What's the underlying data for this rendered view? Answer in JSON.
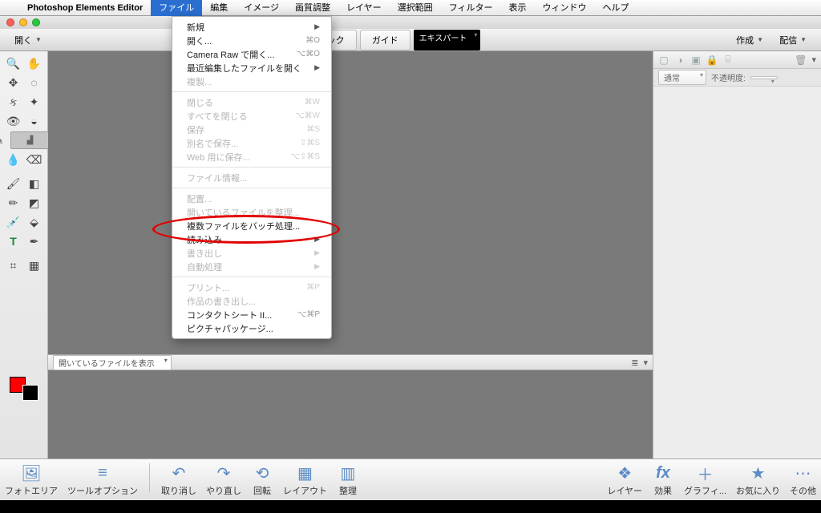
{
  "menubar": {
    "app_name": "Photoshop Elements Editor",
    "items": [
      "ファイル",
      "編集",
      "イメージ",
      "画質調整",
      "レイヤー",
      "選択範囲",
      "フィルター",
      "表示",
      "ウィンドウ",
      "ヘルプ"
    ],
    "active_index": 0
  },
  "topbar": {
    "open_label": "開く",
    "create_label": "作成",
    "deliver_label": "配信",
    "mode_tabs": [
      "クイック",
      "ガイド",
      "エキスパート"
    ],
    "mode_selected": 2
  },
  "file_menu": {
    "groups": [
      [
        {
          "label": "新規",
          "shortcut": "",
          "arrow": true,
          "disabled": false
        },
        {
          "label": "開く...",
          "shortcut": "⌘O",
          "arrow": false,
          "disabled": false
        },
        {
          "label": "Camera Raw で開く...",
          "shortcut": "⌥⌘O",
          "arrow": false,
          "disabled": false
        },
        {
          "label": "最近編集したファイルを開く",
          "shortcut": "",
          "arrow": true,
          "disabled": false
        },
        {
          "label": "複製...",
          "shortcut": "",
          "arrow": false,
          "disabled": true
        }
      ],
      [
        {
          "label": "閉じる",
          "shortcut": "⌘W",
          "arrow": false,
          "disabled": true
        },
        {
          "label": "すべてを閉じる",
          "shortcut": "⌥⌘W",
          "arrow": false,
          "disabled": true
        },
        {
          "label": "保存",
          "shortcut": "⌘S",
          "arrow": false,
          "disabled": true
        },
        {
          "label": "別名で保存...",
          "shortcut": "⇧⌘S",
          "arrow": false,
          "disabled": true
        },
        {
          "label": "Web 用に保存...",
          "shortcut": "⌥⇧⌘S",
          "arrow": false,
          "disabled": true
        }
      ],
      [
        {
          "label": "ファイル情報...",
          "shortcut": "",
          "arrow": false,
          "disabled": true
        }
      ],
      [
        {
          "label": "配置...",
          "shortcut": "",
          "arrow": false,
          "disabled": true
        },
        {
          "label": "開いているファイルを整理...",
          "shortcut": "",
          "arrow": false,
          "disabled": true
        },
        {
          "label": "複数ファイルをバッチ処理...",
          "shortcut": "",
          "arrow": false,
          "disabled": false
        },
        {
          "label": "読み込み",
          "shortcut": "",
          "arrow": true,
          "disabled": false
        },
        {
          "label": "書き出し",
          "shortcut": "",
          "arrow": true,
          "disabled": true
        },
        {
          "label": "自動処理",
          "shortcut": "",
          "arrow": true,
          "disabled": true
        }
      ],
      [
        {
          "label": "プリント...",
          "shortcut": "⌘P",
          "arrow": false,
          "disabled": true
        },
        {
          "label": "作品の書き出し...",
          "shortcut": "",
          "arrow": false,
          "disabled": true
        },
        {
          "label": "コンタクトシート II...",
          "shortcut": "⌥⌘P",
          "arrow": false,
          "disabled": false
        },
        {
          "label": "ピクチャパッケージ...",
          "shortcut": "",
          "arrow": false,
          "disabled": false
        }
      ]
    ]
  },
  "file_dropdown": {
    "label": "開いているファイルを表示"
  },
  "right_panel": {
    "blend_mode": "通常",
    "opacity_label": "不透明度:"
  },
  "bottom": {
    "left": [
      {
        "icon": "🖼",
        "label": "フォトエリア"
      },
      {
        "icon": "≡",
        "label": "ツールオプション"
      }
    ],
    "mid": [
      {
        "icon": "↶",
        "label": "取り消し"
      },
      {
        "icon": "↷",
        "label": "やり直し"
      },
      {
        "icon": "⟲",
        "label": "回転"
      },
      {
        "icon": "▦",
        "label": "レイアウト"
      },
      {
        "icon": "▥",
        "label": "整理"
      }
    ],
    "right": [
      {
        "icon": "❖",
        "label": "レイヤー"
      },
      {
        "icon": "fx",
        "label": "効果"
      },
      {
        "icon": "＋",
        "label": "グラフィ..."
      },
      {
        "icon": "★",
        "label": "お気に入り"
      },
      {
        "icon": "⋯",
        "label": "その他"
      }
    ]
  },
  "tools_left": [
    [
      "zoom-icon",
      "hand-icon"
    ],
    [
      "move-icon",
      "marquee-icon"
    ],
    [
      "lasso-icon",
      "wand-icon"
    ],
    [
      "redeye-icon",
      "spot-icon"
    ],
    [
      "brush-heal-icon",
      "stamp-icon"
    ],
    [
      "drop-icon",
      "eraser-icon"
    ],
    [
      "",
      "",
      ""
    ],
    [
      "brush-icon",
      "sponge-icon"
    ],
    [
      "pencil-icon",
      "gradient-icon"
    ],
    [
      "eyedrop-icon",
      "bucket-icon"
    ],
    [
      "type-icon",
      "pen-icon"
    ],
    [
      "",
      ""
    ],
    [
      "crop-icon",
      "shape-icon"
    ]
  ]
}
